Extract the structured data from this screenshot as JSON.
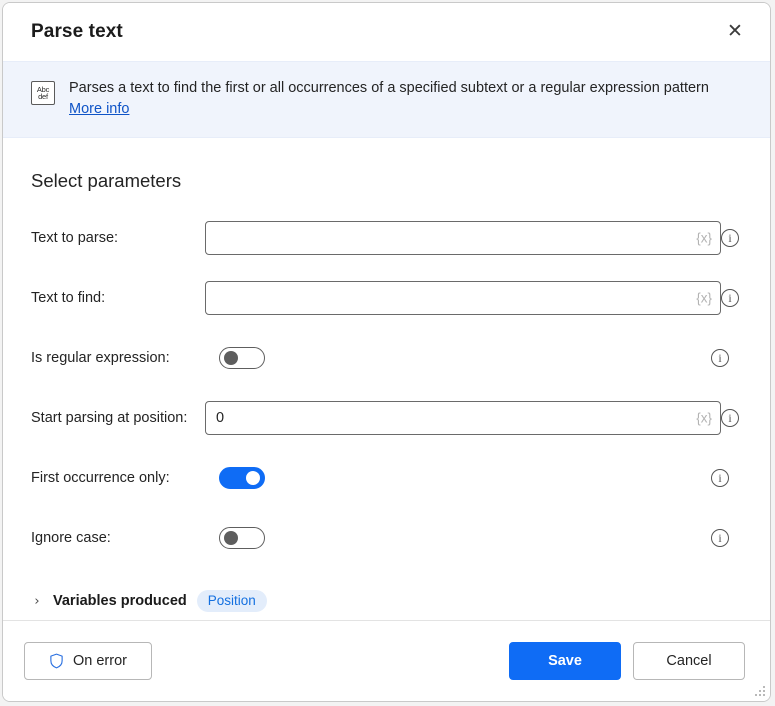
{
  "dialog": {
    "title": "Parse text",
    "close_label": "✕"
  },
  "banner": {
    "icon_top": "Abc",
    "icon_bottom": "def",
    "description": "Parses a text to find the first or all occurrences of a specified subtext or a regular expression pattern",
    "link": "More info"
  },
  "main": {
    "section_title": "Select parameters",
    "variable_button_label": "{x}",
    "info_icon_label": "i",
    "parameters": [
      {
        "label": "Text to parse:",
        "type": "text",
        "value": "",
        "placeholder": "",
        "has_variable_button": true
      },
      {
        "label": "Text to find:",
        "type": "text",
        "value": "",
        "placeholder": "",
        "has_variable_button": true
      },
      {
        "label": "Is regular expression:",
        "type": "toggle",
        "state": "off"
      },
      {
        "label": "Start parsing at position:",
        "type": "text",
        "value": "0",
        "placeholder": "",
        "has_variable_button": true
      },
      {
        "label": "First occurrence only:",
        "type": "toggle",
        "state": "on"
      },
      {
        "label": "Ignore case:",
        "type": "toggle",
        "state": "off"
      }
    ],
    "variables_produced": {
      "chevron": "›",
      "label": "Variables produced",
      "badge": "Position"
    }
  },
  "footer": {
    "on_error_label": "On error",
    "save_label": "Save",
    "cancel_label": "Cancel"
  },
  "colors": {
    "accent": "#0f6cf5",
    "banner_bg": "#f0f4fc",
    "link": "#0f54c7",
    "badge_bg": "#e3edfb",
    "badge_text": "#1470e0",
    "text": "#242424"
  }
}
